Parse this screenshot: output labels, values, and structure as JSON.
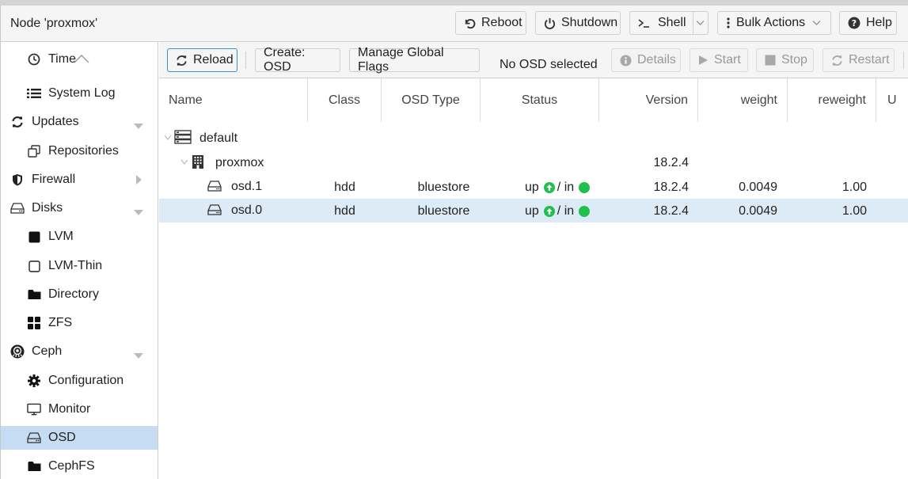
{
  "header": {
    "node_title": "Node 'proxmox'",
    "buttons": {
      "reboot": "Reboot",
      "shutdown": "Shutdown",
      "shell": "Shell",
      "bulk_actions": "Bulk Actions",
      "help": "Help"
    }
  },
  "sidebar": {
    "items": [
      {
        "label": "Time",
        "icon": "clock-icon",
        "level": 1
      },
      {
        "label": "System Log",
        "icon": "list-icon",
        "level": 1
      },
      {
        "label": "Updates",
        "icon": "refresh-icon",
        "level": 0,
        "expandable": "expanded"
      },
      {
        "label": "Repositories",
        "icon": "copy-icon",
        "level": 1
      },
      {
        "label": "Firewall",
        "icon": "shield-icon",
        "level": 0,
        "expandable": "collapsed"
      },
      {
        "label": "Disks",
        "icon": "hdd-icon",
        "level": 0,
        "expandable": "expanded"
      },
      {
        "label": "LVM",
        "icon": "square-filled-icon",
        "level": 1
      },
      {
        "label": "LVM-Thin",
        "icon": "square-outline-icon",
        "level": 1
      },
      {
        "label": "Directory",
        "icon": "folder-icon",
        "level": 1
      },
      {
        "label": "ZFS",
        "icon": "grid-icon",
        "level": 1
      },
      {
        "label": "Ceph",
        "icon": "ceph-icon",
        "level": 0,
        "expandable": "expanded"
      },
      {
        "label": "Configuration",
        "icon": "gear-icon",
        "level": 1
      },
      {
        "label": "Monitor",
        "icon": "monitor-icon",
        "level": 1
      },
      {
        "label": "OSD",
        "icon": "hdd-icon",
        "level": 1,
        "selected": true
      },
      {
        "label": "CephFS",
        "icon": "folder-icon",
        "level": 1
      }
    ]
  },
  "toolbar": {
    "reload": "Reload",
    "create_osd": "Create: OSD",
    "manage_global_flags": "Manage Global Flags",
    "selection_text": "No OSD selected",
    "details": "Details",
    "start": "Start",
    "stop": "Stop",
    "restart": "Restart"
  },
  "grid": {
    "columns": [
      "Name",
      "Class",
      "OSD Type",
      "Status",
      "Version",
      "weight",
      "reweight",
      "U"
    ],
    "rows": [
      {
        "name": "default",
        "icon": "server-icon",
        "level": 0,
        "class": "",
        "osd_type": "",
        "status_up": "",
        "status_in": "",
        "version": "",
        "weight": "",
        "reweight": ""
      },
      {
        "name": "proxmox",
        "icon": "building-icon",
        "level": 1,
        "class": "",
        "osd_type": "",
        "status_up": "",
        "status_in": "",
        "version": "18.2.4",
        "weight": "",
        "reweight": ""
      },
      {
        "name": "osd.1",
        "icon": "hdd-icon",
        "level": 2,
        "class": "hdd",
        "osd_type": "bluestore",
        "status_up": "up",
        "status_in": "/ in",
        "version": "18.2.4",
        "weight": "0.0049",
        "reweight": "1.00"
      },
      {
        "name": "osd.0",
        "icon": "hdd-icon",
        "level": 2,
        "class": "hdd",
        "osd_type": "bluestore",
        "status_up": "up",
        "status_in": "/ in",
        "version": "18.2.4",
        "weight": "0.0049",
        "reweight": "1.00",
        "selected": true
      }
    ]
  },
  "colors": {
    "status_ok": "#21bf4b",
    "selection": "#c5dcf2",
    "row_selection": "#ddebf7",
    "focus_border": "#3892d4"
  }
}
